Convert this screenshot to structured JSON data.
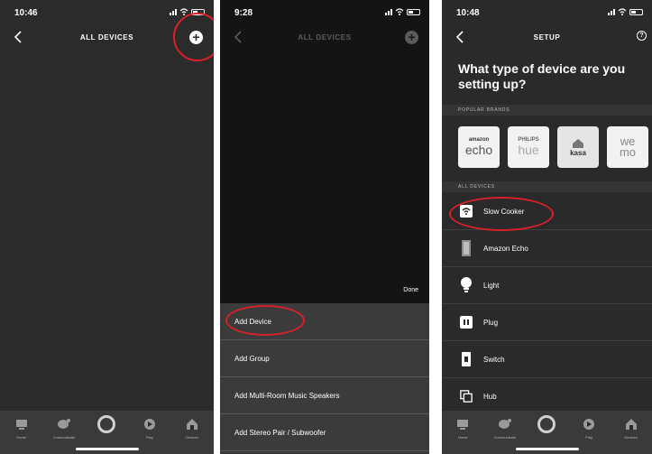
{
  "panel1": {
    "time": "10:46",
    "title": "ALL DEVICES",
    "add_icon": "plus-circle-icon"
  },
  "panel2": {
    "time": "9:28",
    "title": "ALL DEVICES",
    "done_label": "Done",
    "menu": [
      "Add Device",
      "Add Group",
      "Add Multi-Room Music Speakers",
      "Add Stereo Pair / Subwoofer"
    ]
  },
  "panel3": {
    "time": "10:48",
    "title": "SETUP",
    "question": "What type of device are you setting up?",
    "popular_brands_header": "POPULAR BRANDS",
    "brands": [
      {
        "top": "amazon",
        "bottom": "echo"
      },
      {
        "top": "PHILIPS",
        "bottom": "hue"
      },
      {
        "top": "",
        "bottom": "kasa"
      },
      {
        "top": "",
        "bottom": "we mo"
      }
    ],
    "all_devices_header": "ALL DEVICES",
    "devices": [
      "Slow Cooker",
      "Amazon Echo",
      "Light",
      "Plug",
      "Switch",
      "Hub"
    ]
  },
  "tabs": [
    "Home",
    "Communicate",
    "",
    "Play",
    "Devices"
  ],
  "colors": {
    "highlight": "#d62128",
    "background": "#2b2b2b"
  }
}
